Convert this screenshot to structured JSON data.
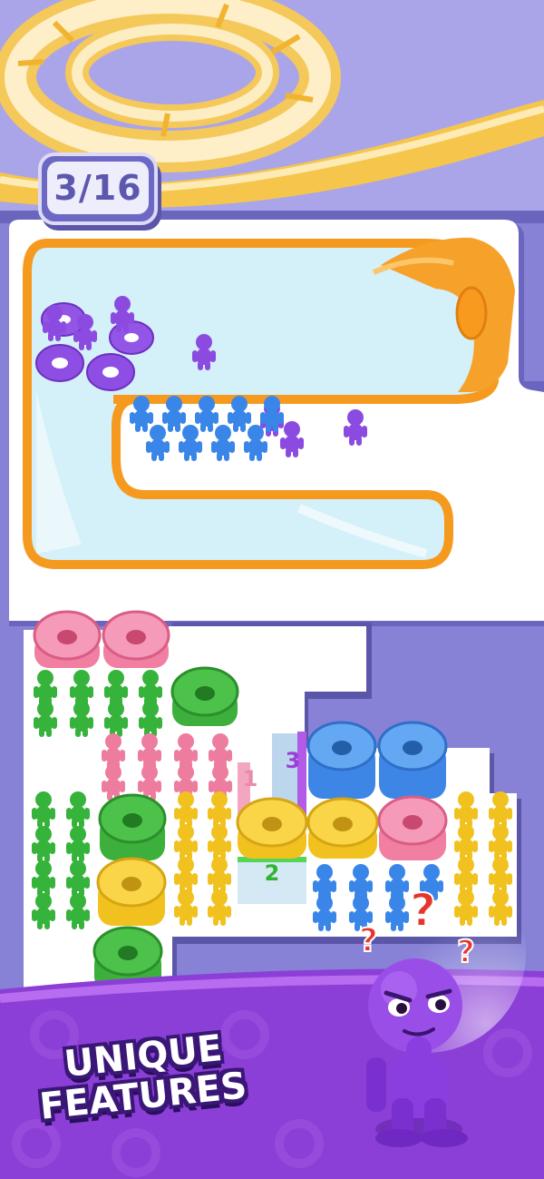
{
  "level": {
    "counter": "3/16"
  },
  "queue_labels": {
    "q1": "1",
    "q2": "2",
    "q3": "3"
  },
  "promo": {
    "line1": "UNIQUE",
    "line2": "FEATURES"
  },
  "colors": {
    "board": "#ffffff",
    "board_shadow": "#5c57ad",
    "pool": "#d3f0f8",
    "rail": "#f79a1e",
    "purple": "#8c4be0",
    "blue": "#3a86e8",
    "pink": "#ef7fa1",
    "green": "#3bb63c",
    "yellow": "#f4c624"
  }
}
